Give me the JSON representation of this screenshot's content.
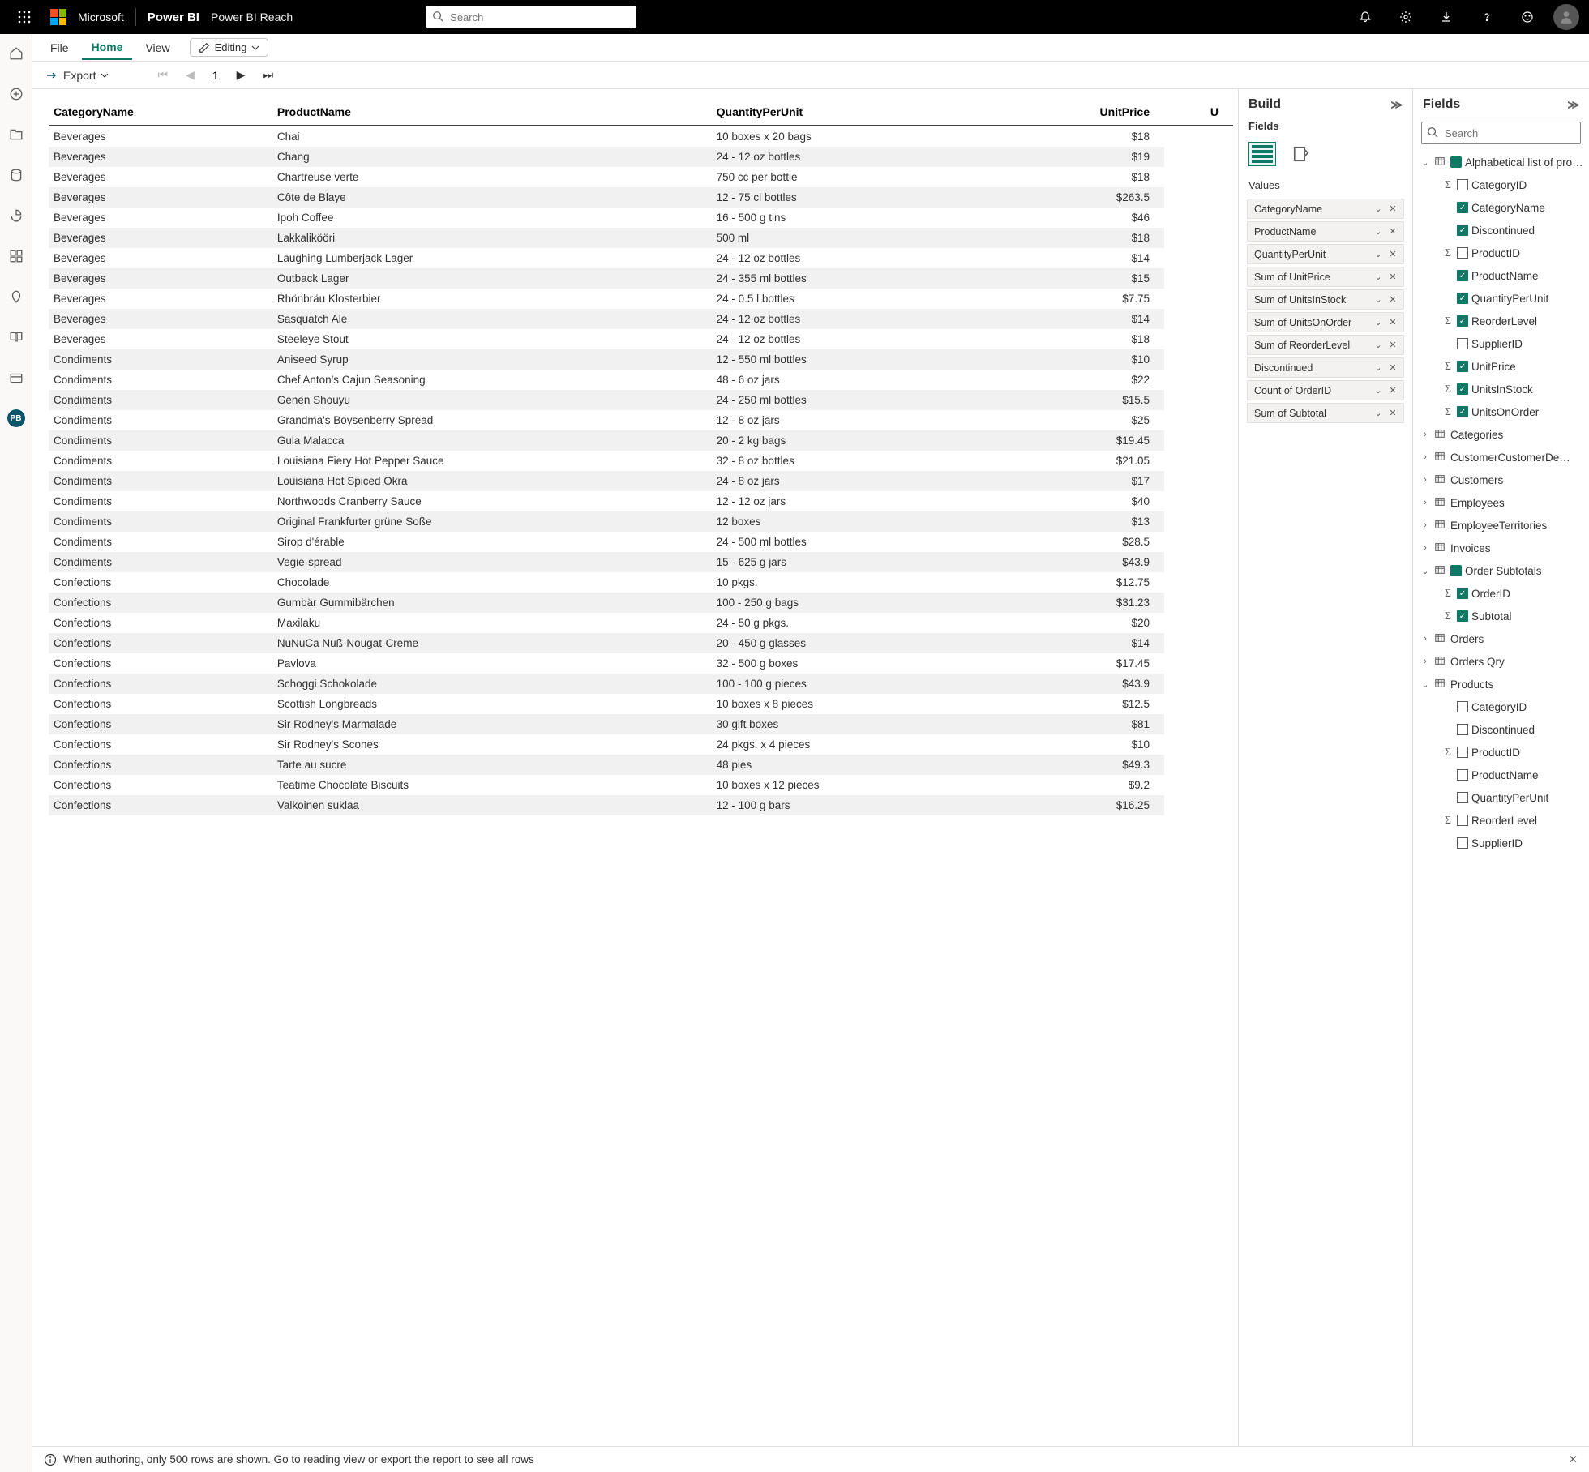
{
  "header": {
    "brand": "Power BI",
    "workspace": "Power BI Reach",
    "search_placeholder": "Search"
  },
  "ribbon": {
    "tabs": [
      "File",
      "Home",
      "View"
    ],
    "active": "Home",
    "editing_label": "Editing"
  },
  "pagerbar": {
    "export_label": "Export",
    "page_number": "1"
  },
  "leftrail_badge": "PB",
  "build": {
    "title": "Build",
    "fields_label": "Fields",
    "values_label": "Values",
    "values": [
      "CategoryName",
      "ProductName",
      "QuantityPerUnit",
      "Sum of UnitPrice",
      "Sum of UnitsInStock",
      "Sum of UnitsOnOrder",
      "Sum of ReorderLevel",
      "Discontinued",
      "Count of OrderID",
      "Sum of Subtotal"
    ]
  },
  "fields": {
    "title": "Fields",
    "search_placeholder": "Search",
    "tables": [
      {
        "name": "Alphabetical list of pro…",
        "expanded": true,
        "highlighted": true,
        "cols": [
          {
            "name": "CategoryID",
            "sigma": true,
            "checked": false
          },
          {
            "name": "CategoryName",
            "sigma": false,
            "checked": true
          },
          {
            "name": "Discontinued",
            "sigma": false,
            "checked": true
          },
          {
            "name": "ProductID",
            "sigma": true,
            "checked": false
          },
          {
            "name": "ProductName",
            "sigma": false,
            "checked": true
          },
          {
            "name": "QuantityPerUnit",
            "sigma": false,
            "checked": true
          },
          {
            "name": "ReorderLevel",
            "sigma": true,
            "checked": true
          },
          {
            "name": "SupplierID",
            "sigma": false,
            "checked": false
          },
          {
            "name": "UnitPrice",
            "sigma": true,
            "checked": true
          },
          {
            "name": "UnitsInStock",
            "sigma": true,
            "checked": true
          },
          {
            "name": "UnitsOnOrder",
            "sigma": true,
            "checked": true
          }
        ]
      },
      {
        "name": "Categories",
        "expanded": false
      },
      {
        "name": "CustomerCustomerDe…",
        "expanded": false
      },
      {
        "name": "Customers",
        "expanded": false
      },
      {
        "name": "Employees",
        "expanded": false
      },
      {
        "name": "EmployeeTerritories",
        "expanded": false
      },
      {
        "name": "Invoices",
        "expanded": false
      },
      {
        "name": "Order Subtotals",
        "expanded": true,
        "highlighted": true,
        "cols": [
          {
            "name": "OrderID",
            "sigma": true,
            "checked": true
          },
          {
            "name": "Subtotal",
            "sigma": true,
            "checked": true
          }
        ]
      },
      {
        "name": "Orders",
        "expanded": false
      },
      {
        "name": "Orders Qry",
        "expanded": false
      },
      {
        "name": "Products",
        "expanded": true,
        "highlighted": false,
        "cols": [
          {
            "name": "CategoryID",
            "sigma": false,
            "checked": false
          },
          {
            "name": "Discontinued",
            "sigma": false,
            "checked": false
          },
          {
            "name": "ProductID",
            "sigma": true,
            "checked": false
          },
          {
            "name": "ProductName",
            "sigma": false,
            "checked": false
          },
          {
            "name": "QuantityPerUnit",
            "sigma": false,
            "checked": false
          },
          {
            "name": "ReorderLevel",
            "sigma": true,
            "checked": false
          },
          {
            "name": "SupplierID",
            "sigma": false,
            "checked": false
          }
        ]
      }
    ]
  },
  "report": {
    "columns": [
      "CategoryName",
      "ProductName",
      "QuantityPerUnit",
      "UnitPrice",
      "U"
    ],
    "rows": [
      [
        "Beverages",
        "Chai",
        "10 boxes x 20 bags",
        "$18"
      ],
      [
        "Beverages",
        "Chang",
        "24 - 12 oz bottles",
        "$19"
      ],
      [
        "Beverages",
        "Chartreuse verte",
        "750 cc per bottle",
        "$18"
      ],
      [
        "Beverages",
        "Côte de Blaye",
        "12 - 75 cl bottles",
        "$263.5"
      ],
      [
        "Beverages",
        "Ipoh Coffee",
        "16 - 500 g tins",
        "$46"
      ],
      [
        "Beverages",
        "Lakkalikööri",
        "500 ml",
        "$18"
      ],
      [
        "Beverages",
        "Laughing Lumberjack Lager",
        "24 - 12 oz bottles",
        "$14"
      ],
      [
        "Beverages",
        "Outback Lager",
        "24 - 355 ml bottles",
        "$15"
      ],
      [
        "Beverages",
        "Rhönbräu Klosterbier",
        "24 - 0.5 l bottles",
        "$7.75"
      ],
      [
        "Beverages",
        "Sasquatch Ale",
        "24 - 12 oz bottles",
        "$14"
      ],
      [
        "Beverages",
        "Steeleye Stout",
        "24 - 12 oz bottles",
        "$18"
      ],
      [
        "Condiments",
        "Aniseed Syrup",
        "12 - 550 ml bottles",
        "$10"
      ],
      [
        "Condiments",
        "Chef Anton's Cajun Seasoning",
        "48 - 6 oz jars",
        "$22"
      ],
      [
        "Condiments",
        "Genen Shouyu",
        "24 - 250 ml bottles",
        "$15.5"
      ],
      [
        "Condiments",
        "Grandma's Boysenberry Spread",
        "12 - 8 oz jars",
        "$25"
      ],
      [
        "Condiments",
        "Gula Malacca",
        "20 - 2 kg bags",
        "$19.45"
      ],
      [
        "Condiments",
        "Louisiana Fiery Hot Pepper Sauce",
        "32 - 8 oz bottles",
        "$21.05"
      ],
      [
        "Condiments",
        "Louisiana Hot Spiced Okra",
        "24 - 8 oz jars",
        "$17"
      ],
      [
        "Condiments",
        "Northwoods Cranberry Sauce",
        "12 - 12 oz jars",
        "$40"
      ],
      [
        "Condiments",
        "Original Frankfurter grüne Soße",
        "12 boxes",
        "$13"
      ],
      [
        "Condiments",
        "Sirop d'érable",
        "24 - 500 ml bottles",
        "$28.5"
      ],
      [
        "Condiments",
        "Vegie-spread",
        "15 - 625 g jars",
        "$43.9"
      ],
      [
        "Confections",
        "Chocolade",
        "10 pkgs.",
        "$12.75"
      ],
      [
        "Confections",
        "Gumbär Gummibärchen",
        "100 - 250 g bags",
        "$31.23"
      ],
      [
        "Confections",
        "Maxilaku",
        "24 - 50 g pkgs.",
        "$20"
      ],
      [
        "Confections",
        "NuNuCa Nuß-Nougat-Creme",
        "20 - 450 g glasses",
        "$14"
      ],
      [
        "Confections",
        "Pavlova",
        "32 - 500 g boxes",
        "$17.45"
      ],
      [
        "Confections",
        "Schoggi Schokolade",
        "100 - 100 g pieces",
        "$43.9"
      ],
      [
        "Confections",
        "Scottish Longbreads",
        "10 boxes x 8 pieces",
        "$12.5"
      ],
      [
        "Confections",
        "Sir Rodney's Marmalade",
        "30 gift boxes",
        "$81"
      ],
      [
        "Confections",
        "Sir Rodney's Scones",
        "24 pkgs. x 4 pieces",
        "$10"
      ],
      [
        "Confections",
        "Tarte au sucre",
        "48 pies",
        "$49.3"
      ],
      [
        "Confections",
        "Teatime Chocolate Biscuits",
        "10 boxes x 12 pieces",
        "$9.2"
      ],
      [
        "Confections",
        "Valkoinen suklaa",
        "12 - 100 g bars",
        "$16.25"
      ]
    ]
  },
  "notice": "When authoring, only 500 rows are shown. Go to reading view or export the report to see all rows"
}
